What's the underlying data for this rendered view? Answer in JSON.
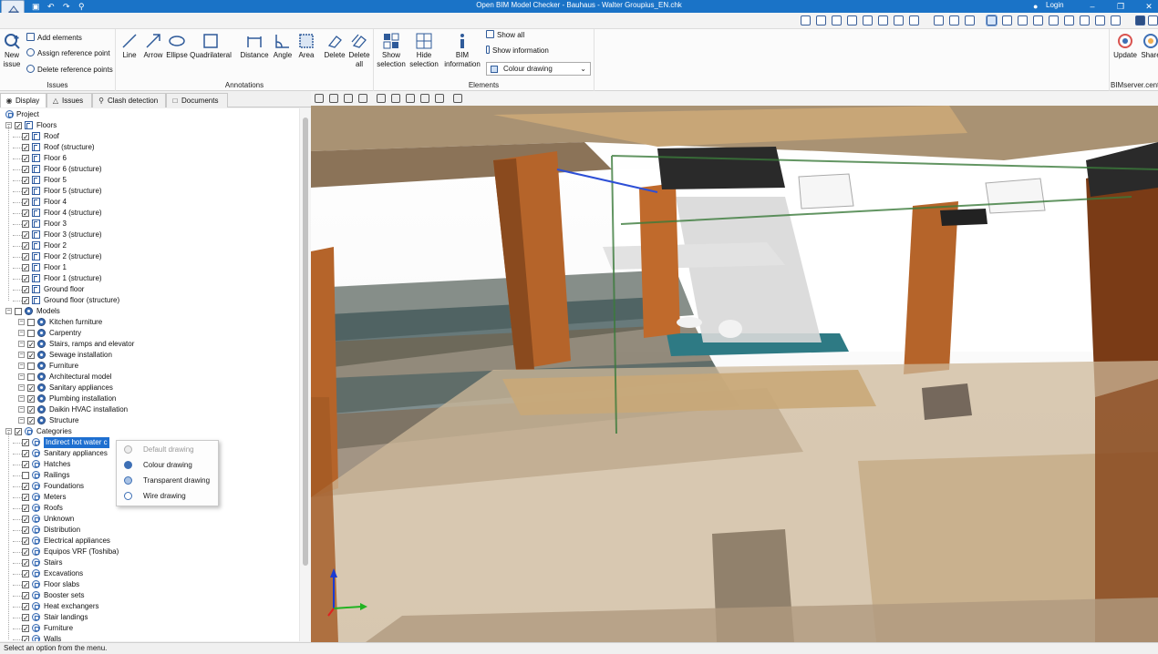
{
  "app": {
    "title": "Open BIM Model Checker - Bauhaus - Walter Groupius_EN.chk",
    "login_label": "Login"
  },
  "ribbon": {
    "issues": {
      "group_label": "Issues",
      "new_issue": "New issue",
      "add_elements": "Add elements",
      "assign_reference_point": "Assign reference point",
      "delete_reference_points": "Delete reference points"
    },
    "annotations": {
      "group_label": "Annotations",
      "line": "Line",
      "arrow": "Arrow",
      "ellipse": "Ellipse",
      "quadrilateral": "Quadrilateral",
      "distance": "Distance",
      "angle": "Angle",
      "area": "Area",
      "delete": "Delete",
      "delete_all": "Delete all"
    },
    "elements": {
      "group_label": "Elements",
      "show_selection": "Show selection",
      "hide_selection": "Hide selection",
      "bim_information": "BIM information",
      "show_all": "Show all",
      "show_information": "Show information",
      "drawing_mode": "Colour drawing"
    },
    "bimserver": {
      "group_label": "BIMserver.cent",
      "update": "Update",
      "share": "Share"
    }
  },
  "tabs": [
    {
      "label": "Display",
      "icon": "eye-icon"
    },
    {
      "label": "Issues",
      "icon": "warning-icon"
    },
    {
      "label": "Clash detection",
      "icon": "magnifier-icon"
    },
    {
      "label": "Documents",
      "icon": "document-icon"
    }
  ],
  "tree": {
    "project": "Project",
    "floors_label": "Floors",
    "floors": [
      "Roof",
      "Roof (structure)",
      "Floor 6",
      "Floor 6 (structure)",
      "Floor 5",
      "Floor 5 (structure)",
      "Floor 4",
      "Floor 4 (structure)",
      "Floor 3",
      "Floor 3 (structure)",
      "Floor 2",
      "Floor 2 (structure)",
      "Floor 1",
      "Floor 1 (structure)",
      "Ground floor",
      "Ground floor (structure)"
    ],
    "models_label": "Models",
    "models": [
      {
        "label": "Kitchen furniture",
        "checked": false
      },
      {
        "label": "Carpentry",
        "checked": false
      },
      {
        "label": "Stairs, ramps and elevator",
        "checked": true
      },
      {
        "label": "Sewage installation",
        "checked": true
      },
      {
        "label": "Furniture",
        "checked": false
      },
      {
        "label": "Architectural model",
        "checked": false
      },
      {
        "label": "Sanitary appliances",
        "checked": true
      },
      {
        "label": "Plumbing installation",
        "checked": true
      },
      {
        "label": "Daikin HVAC installation",
        "checked": true
      },
      {
        "label": "Structure",
        "checked": true
      }
    ],
    "categories_label": "Categories",
    "categories": [
      {
        "label": "Indirect hot water c",
        "checked": true,
        "selected": true
      },
      {
        "label": "Sanitary appliances",
        "checked": true
      },
      {
        "label": "Hatches",
        "checked": true
      },
      {
        "label": "Railings",
        "checked": false
      },
      {
        "label": "Foundations",
        "checked": true
      },
      {
        "label": "Meters",
        "checked": true
      },
      {
        "label": "Roofs",
        "checked": true
      },
      {
        "label": "Unknown",
        "checked": true
      },
      {
        "label": "Distribution",
        "checked": true
      },
      {
        "label": "Electrical appliances",
        "checked": true
      },
      {
        "label": "Equipos VRF (Toshiba)",
        "checked": true
      },
      {
        "label": "Stairs",
        "checked": true
      },
      {
        "label": "Excavations",
        "checked": true
      },
      {
        "label": "Floor slabs",
        "checked": true
      },
      {
        "label": "Booster sets",
        "checked": true
      },
      {
        "label": "Heat exchangers",
        "checked": true
      },
      {
        "label": "Stair landings",
        "checked": true
      },
      {
        "label": "Furniture",
        "checked": true
      },
      {
        "label": "Walls",
        "checked": true
      }
    ]
  },
  "context_menu": {
    "items": [
      {
        "label": "Default drawing",
        "disabled": true
      },
      {
        "label": "Colour drawing",
        "disabled": false
      },
      {
        "label": "Transparent drawing",
        "disabled": false
      },
      {
        "label": "Wire drawing",
        "disabled": false
      }
    ]
  },
  "status_bar": {
    "text": "Select an option from the menu."
  },
  "colors": {
    "titlebar": "#1a73c7",
    "selection": "#1e6fd0",
    "accent": "#2f5b9a"
  }
}
